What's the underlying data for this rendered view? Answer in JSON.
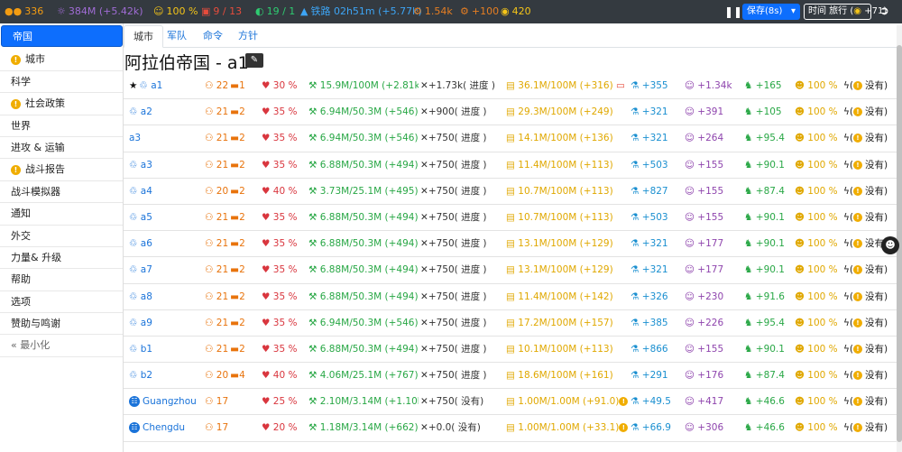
{
  "topbar": {
    "population": "336",
    "culture": "384M (+5.42k)",
    "stability": "100 %",
    "army": "9 / 13",
    "cities": "19 / 1",
    "railway": "铁路 02h51m (+5.77k)",
    "production": "1.54k",
    "bonus": "+100",
    "gold": "420",
    "save_label": "保存(8s)",
    "time_travel_label": "时间 旅行",
    "time_travel_count": "+71"
  },
  "sidebar": {
    "items": [
      {
        "label": "帝国",
        "warn": false
      },
      {
        "label": "城市",
        "warn": true
      },
      {
        "label": "科学",
        "warn": false
      },
      {
        "label": "社会政策",
        "warn": true
      },
      {
        "label": "世界",
        "warn": false
      },
      {
        "label": "进攻 & 运输",
        "warn": false
      },
      {
        "label": "战斗报告",
        "warn": true
      },
      {
        "label": "战斗模拟器",
        "warn": false
      },
      {
        "label": "通知",
        "warn": false
      },
      {
        "label": "外交",
        "warn": false
      },
      {
        "label": "力量& 升级",
        "warn": false
      },
      {
        "label": "帮助",
        "warn": false
      },
      {
        "label": "选项",
        "warn": false
      },
      {
        "label": "赞助与鸣谢",
        "warn": false
      }
    ],
    "minimize_label": "最小化"
  },
  "tabs": [
    "城市",
    "军队",
    "命令",
    "方针"
  ],
  "page_title": "阿拉伯帝国 - a1",
  "none_label": "没有)",
  "rows": [
    {
      "name": "a1",
      "icon": "star",
      "pop": "22",
      "slots": "1",
      "happy": "30 %",
      "prod": "15.9M/100M (+2.81k)",
      "prog": "+1.73k( 进度 )",
      "gold": "36.1M/100M (+316)",
      "sci": "+355",
      "cul": "+1.34k",
      "inf": "+165",
      "stab": "100 %"
    },
    {
      "name": "a2",
      "icon": "recycle",
      "pop": "21",
      "slots": "2",
      "happy": "35 %",
      "prod": "6.94M/50.3M (+546)",
      "prog": "+900( 进度 )",
      "gold": "29.3M/100M (+249)",
      "sci": "+321",
      "cul": "+391",
      "inf": "+105",
      "stab": "100 %"
    },
    {
      "name": "a3",
      "icon": "none",
      "pop": "21",
      "slots": "2",
      "happy": "35 %",
      "prod": "6.94M/50.3M (+546)",
      "prog": "+750( 进度 )",
      "gold": "14.1M/100M (+136)",
      "sci": "+321",
      "cul": "+264",
      "inf": "+95.4",
      "stab": "100 %"
    },
    {
      "name": "a3",
      "icon": "recycle",
      "pop": "21",
      "slots": "2",
      "happy": "35 %",
      "prod": "6.88M/50.3M (+494)",
      "prog": "+750( 进度 )",
      "gold": "11.4M/100M (+113)",
      "sci": "+503",
      "cul": "+155",
      "inf": "+90.1",
      "stab": "100 %"
    },
    {
      "name": "a4",
      "icon": "recycle",
      "pop": "20",
      "slots": "2",
      "happy": "40 %",
      "prod": "3.73M/25.1M (+495)",
      "prog": "+750( 进度 )",
      "gold": "10.7M/100M (+113)",
      "sci": "+827",
      "cul": "+155",
      "inf": "+87.4",
      "stab": "100 %"
    },
    {
      "name": "a5",
      "icon": "recycle",
      "pop": "21",
      "slots": "2",
      "happy": "35 %",
      "prod": "6.88M/50.3M (+494)",
      "prog": "+750( 进度 )",
      "gold": "10.7M/100M (+113)",
      "sci": "+503",
      "cul": "+155",
      "inf": "+90.1",
      "stab": "100 %"
    },
    {
      "name": "a6",
      "icon": "recycle",
      "pop": "21",
      "slots": "2",
      "happy": "35 %",
      "prod": "6.88M/50.3M (+494)",
      "prog": "+750( 进度 )",
      "gold": "13.1M/100M (+129)",
      "sci": "+321",
      "cul": "+177",
      "inf": "+90.1",
      "stab": "100 %"
    },
    {
      "name": "a7",
      "icon": "recycle",
      "pop": "21",
      "slots": "2",
      "happy": "35 %",
      "prod": "6.88M/50.3M (+494)",
      "prog": "+750( 进度 )",
      "gold": "13.1M/100M (+129)",
      "sci": "+321",
      "cul": "+177",
      "inf": "+90.1",
      "stab": "100 %"
    },
    {
      "name": "a8",
      "icon": "recycle",
      "pop": "21",
      "slots": "2",
      "happy": "35 %",
      "prod": "6.88M/50.3M (+494)",
      "prog": "+750( 进度 )",
      "gold": "11.4M/100M (+142)",
      "sci": "+326",
      "cul": "+230",
      "inf": "+91.6",
      "stab": "100 %"
    },
    {
      "name": "a9",
      "icon": "recycle",
      "pop": "21",
      "slots": "2",
      "happy": "35 %",
      "prod": "6.94M/50.3M (+546)",
      "prog": "+750( 进度 )",
      "gold": "17.2M/100M (+157)",
      "sci": "+385",
      "cul": "+226",
      "inf": "+95.4",
      "stab": "100 %"
    },
    {
      "name": "b1",
      "icon": "recycle",
      "pop": "21",
      "slots": "2",
      "happy": "35 %",
      "prod": "6.88M/50.3M (+494)",
      "prog": "+750( 进度 )",
      "gold": "10.1M/100M (+113)",
      "sci": "+866",
      "cul": "+155",
      "inf": "+90.1",
      "stab": "100 %"
    },
    {
      "name": "b2",
      "icon": "recycle",
      "pop": "20",
      "slots": "4",
      "happy": "40 %",
      "prod": "4.06M/25.1M (+767)",
      "prog": "+750( 进度 )",
      "gold": "18.6M/100M (+161)",
      "sci": "+291",
      "cul": "+176",
      "inf": "+87.4",
      "stab": "100 %"
    },
    {
      "name": "Guangzhou",
      "icon": "city",
      "pop": "17",
      "slots": "",
      "happy": "25 %",
      "prod": "2.10M/3.14M (+1.10k)",
      "prog": "+750( 没有)",
      "gold": "1.00M/1.00M (+91.0)",
      "sci": "+49.5",
      "cul": "+417",
      "inf": "+46.6",
      "stab": "100 %"
    },
    {
      "name": "Chengdu",
      "icon": "city",
      "pop": "17",
      "slots": "",
      "happy": "20 %",
      "prod": "1.18M/3.14M (+662)",
      "prog": "+0.0( 没有)",
      "gold": "1.00M/1.00M (+33.1)",
      "sci": "+66.9",
      "cul": "+306",
      "inf": "+46.6",
      "stab": "100 %"
    }
  ]
}
